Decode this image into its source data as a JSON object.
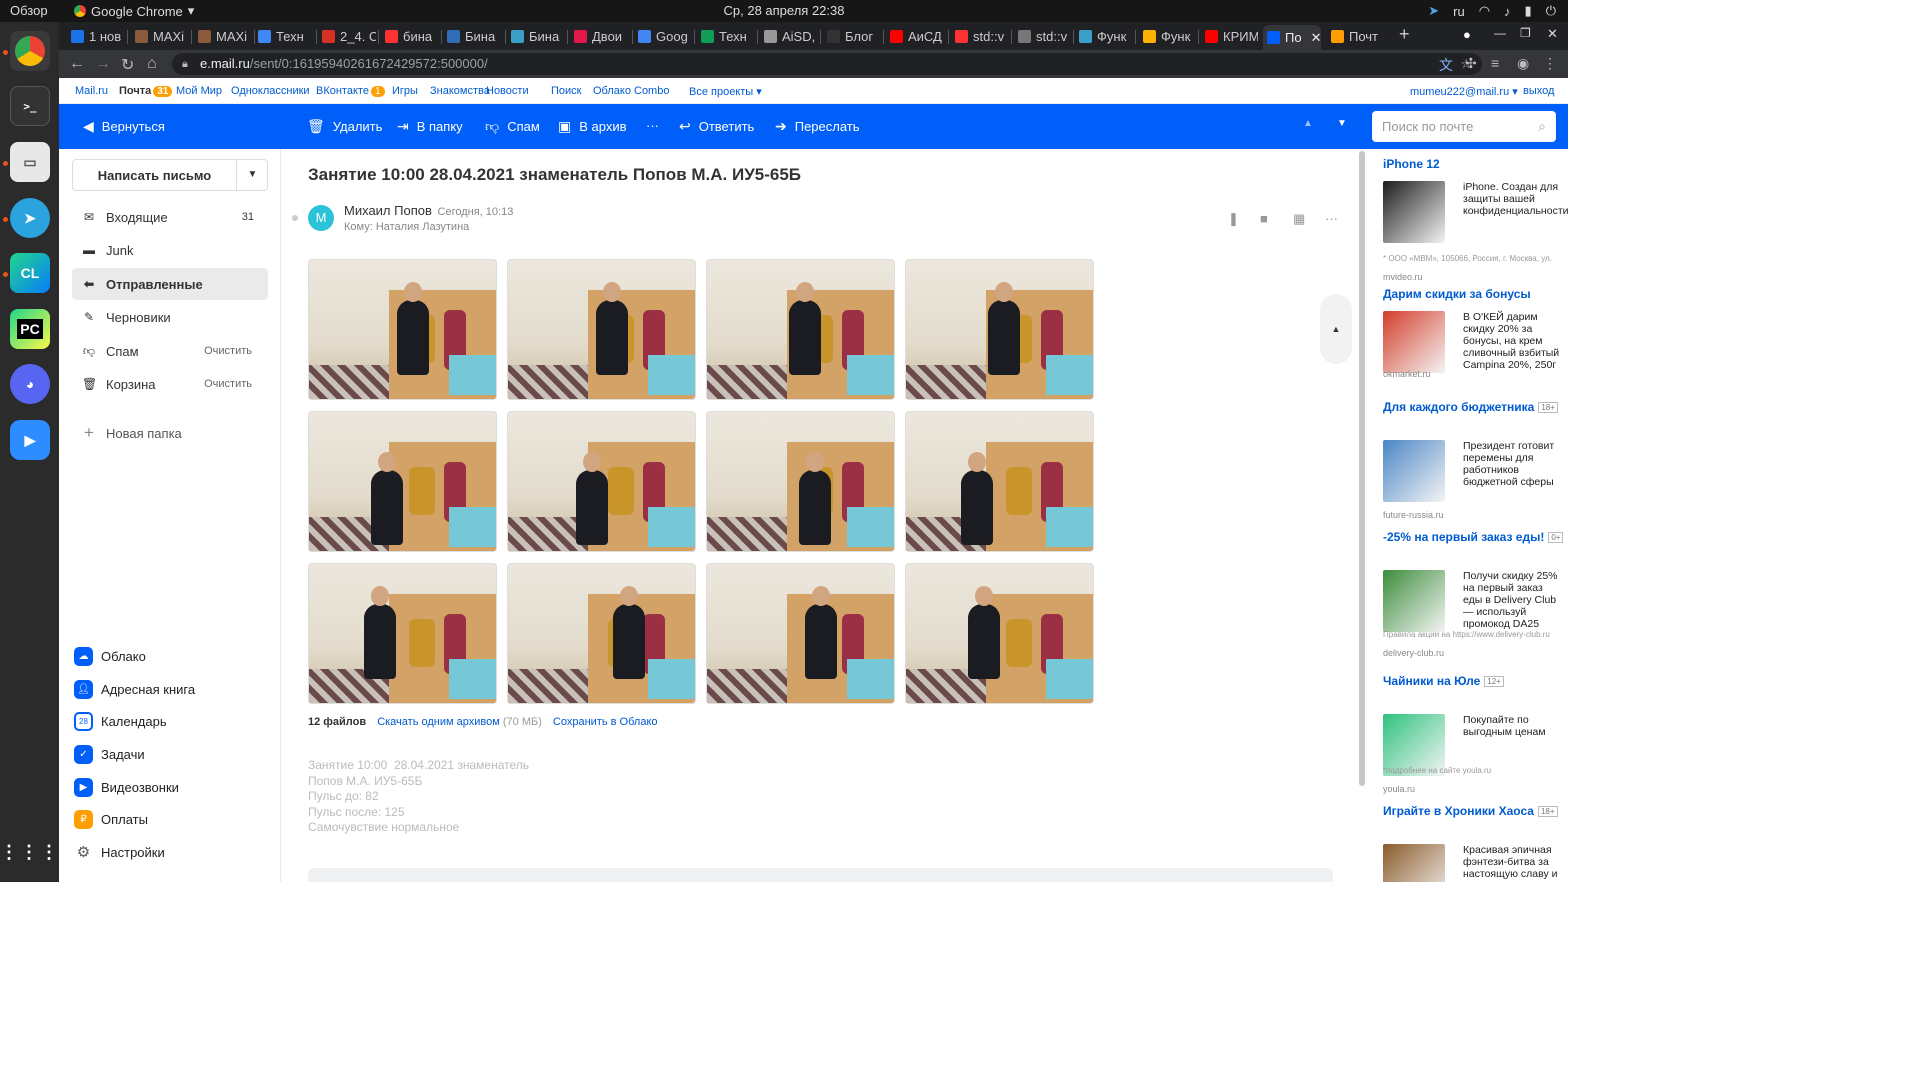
{
  "os": {
    "overview": "Обзор",
    "app_menu": "Google Chrome",
    "clock": "Ср, 28 апреля  22:38",
    "lang": "ru"
  },
  "tabs": [
    {
      "label": "1 нов",
      "color": "#1a73e8"
    },
    {
      "label": "MAXi",
      "color": "#8a5a3a"
    },
    {
      "label": "MAXi",
      "color": "#8a5a3a"
    },
    {
      "label": "Техн",
      "color": "#4285f4"
    },
    {
      "label": "2_4. С",
      "color": "#d93025"
    },
    {
      "label": "бина",
      "color": "#ff3333"
    },
    {
      "label": "Бина",
      "color": "#2f6db5"
    },
    {
      "label": "Бина",
      "color": "#3aa0c8"
    },
    {
      "label": "Двои",
      "color": "#e0194a"
    },
    {
      "label": "Goog",
      "color": "#4285f4"
    },
    {
      "label": "Техн",
      "color": "#0f9d58"
    },
    {
      "label": "AiSD,",
      "color": "#999999"
    },
    {
      "label": "Блог",
      "color": "#333333"
    },
    {
      "label": "АиСД",
      "color": "#ff0000"
    },
    {
      "label": "std::v",
      "color": "#ff3333"
    },
    {
      "label": "std::v",
      "color": "#777777"
    },
    {
      "label": "Функ",
      "color": "#3aa0c8"
    },
    {
      "label": "Функ",
      "color": "#ffb000"
    },
    {
      "label": "КРИМ",
      "color": "#ff0000"
    },
    {
      "label": "По",
      "color": "#005ff9"
    },
    {
      "label": "Почт",
      "color": "#ff9e00"
    }
  ],
  "address": {
    "host": "e.mail.ru",
    "path": "/sent/0:16195940261672429572:500000/"
  },
  "portal": {
    "links": [
      "Mail.ru",
      "Почта",
      "Мой Мир",
      "Одноклассники",
      "ВКонтакте",
      "Игры",
      "Знакомства",
      "Новости",
      "Поиск",
      "Облако",
      "Combo",
      "Все проекты ▾"
    ],
    "mail_badge": "31",
    "vk_badge": "1",
    "account": "mumeu222@mail.ru ▾",
    "logout": "выход"
  },
  "toolbar": {
    "back": "Вернуться",
    "delete": "Удалить",
    "to_folder": "В папку",
    "spam": "Спам",
    "archive": "В архив",
    "more": "···",
    "reply": "Ответить",
    "forward": "Переслать",
    "search_placeholder": "Поиск по почте"
  },
  "sidebar": {
    "compose": "Написать письмо",
    "folders": [
      {
        "label": "Входящие",
        "count": "31",
        "icon": "inbox-icon"
      },
      {
        "label": "Junk",
        "count": "",
        "icon": "folder-icon"
      },
      {
        "label": "Отправленные",
        "count": "",
        "icon": "sent-icon"
      },
      {
        "label": "Черновики",
        "count": "",
        "icon": "draft-icon"
      },
      {
        "label": "Спам",
        "clear": "Очистить",
        "icon": "spam-icon"
      },
      {
        "label": "Корзина",
        "clear": "Очистить",
        "icon": "trash-icon"
      }
    ],
    "new_folder": "Новая папка",
    "apps": [
      {
        "label": "Облако",
        "color": "#005ff9"
      },
      {
        "label": "Адресная книга",
        "color": "#005ff9"
      },
      {
        "label": "Календарь",
        "color": "#005ff9",
        "glyph": "28"
      },
      {
        "label": "Задачи",
        "color": "#005ff9"
      },
      {
        "label": "Видеозвонки",
        "color": "#005ff9"
      },
      {
        "label": "Оплаты",
        "color": "#ff9e00"
      },
      {
        "label": "Настройки",
        "color": "#555555"
      }
    ]
  },
  "email": {
    "subject": "Занятие 10:00 28.04.2021 знаменатель Попов М.А. ИУ5-65Б",
    "avatar_letter": "М",
    "sender": "Михаил Попов",
    "date": "Сегодня, 10:13",
    "recipient": "Кому: Наталия Лазутина",
    "files_count": "12 файлов",
    "download_all": "Скачать одним архивом",
    "archive_size": "(70 МБ)",
    "save_cloud": "Сохранить в Облако",
    "body": [
      "Занятие 10:00  28.04.2021 знаменатель",
      "Попов М.А. ИУ5-65Б",
      "Пульс до: 82",
      "Пульс после: 125",
      "Самочувствие нормальное"
    ]
  },
  "ads": [
    {
      "title": "iPhone 12",
      "age": "",
      "desc": "iPhone. Создан для защиты вашей конфиденциальности.",
      "note": "* ООО «МВМ», 105066, Россия, г. Москва, ул.",
      "domain": "mvideo.ru",
      "color": "#1c1c1c"
    },
    {
      "title": "Дарим скидки за бонусы",
      "age": "",
      "desc": "В О'КЕЙ дарим скидку 20% за бонусы, на крем сливочный взбитый Campina 20%, 250г",
      "note": "",
      "domain": "okmarket.ru",
      "color": "#d43d2a"
    },
    {
      "title": "Для каждого бюджетника",
      "age": "18+",
      "desc": "Президент готовит перемены для работников бюджетной сферы",
      "note": "",
      "domain": "future-russia.ru",
      "color": "#4a86c5"
    },
    {
      "title": "-25% на первый заказ еды!",
      "age": "0+",
      "desc": "Получи скидку 25% на первый заказ еды в Delivery Club — используй промокод DA25",
      "note": "Правила акции на https://www.delivery-club.ru",
      "domain": "delivery-club.ru",
      "color": "#3b8d3a"
    },
    {
      "title": "Чайники на Юле",
      "age": "12+",
      "desc": "Покупайте по выгодным ценам",
      "note": "*подробнее на сайте youla.ru",
      "domain": "youla.ru",
      "color": "#2ec27e"
    },
    {
      "title": "Играйте в Хроники Хаоса",
      "age": "18+",
      "desc": "Красивая эпичная фэнтези-битва за настоящую славу и",
      "note": "",
      "domain": "",
      "color": "#8a5a2a"
    }
  ]
}
